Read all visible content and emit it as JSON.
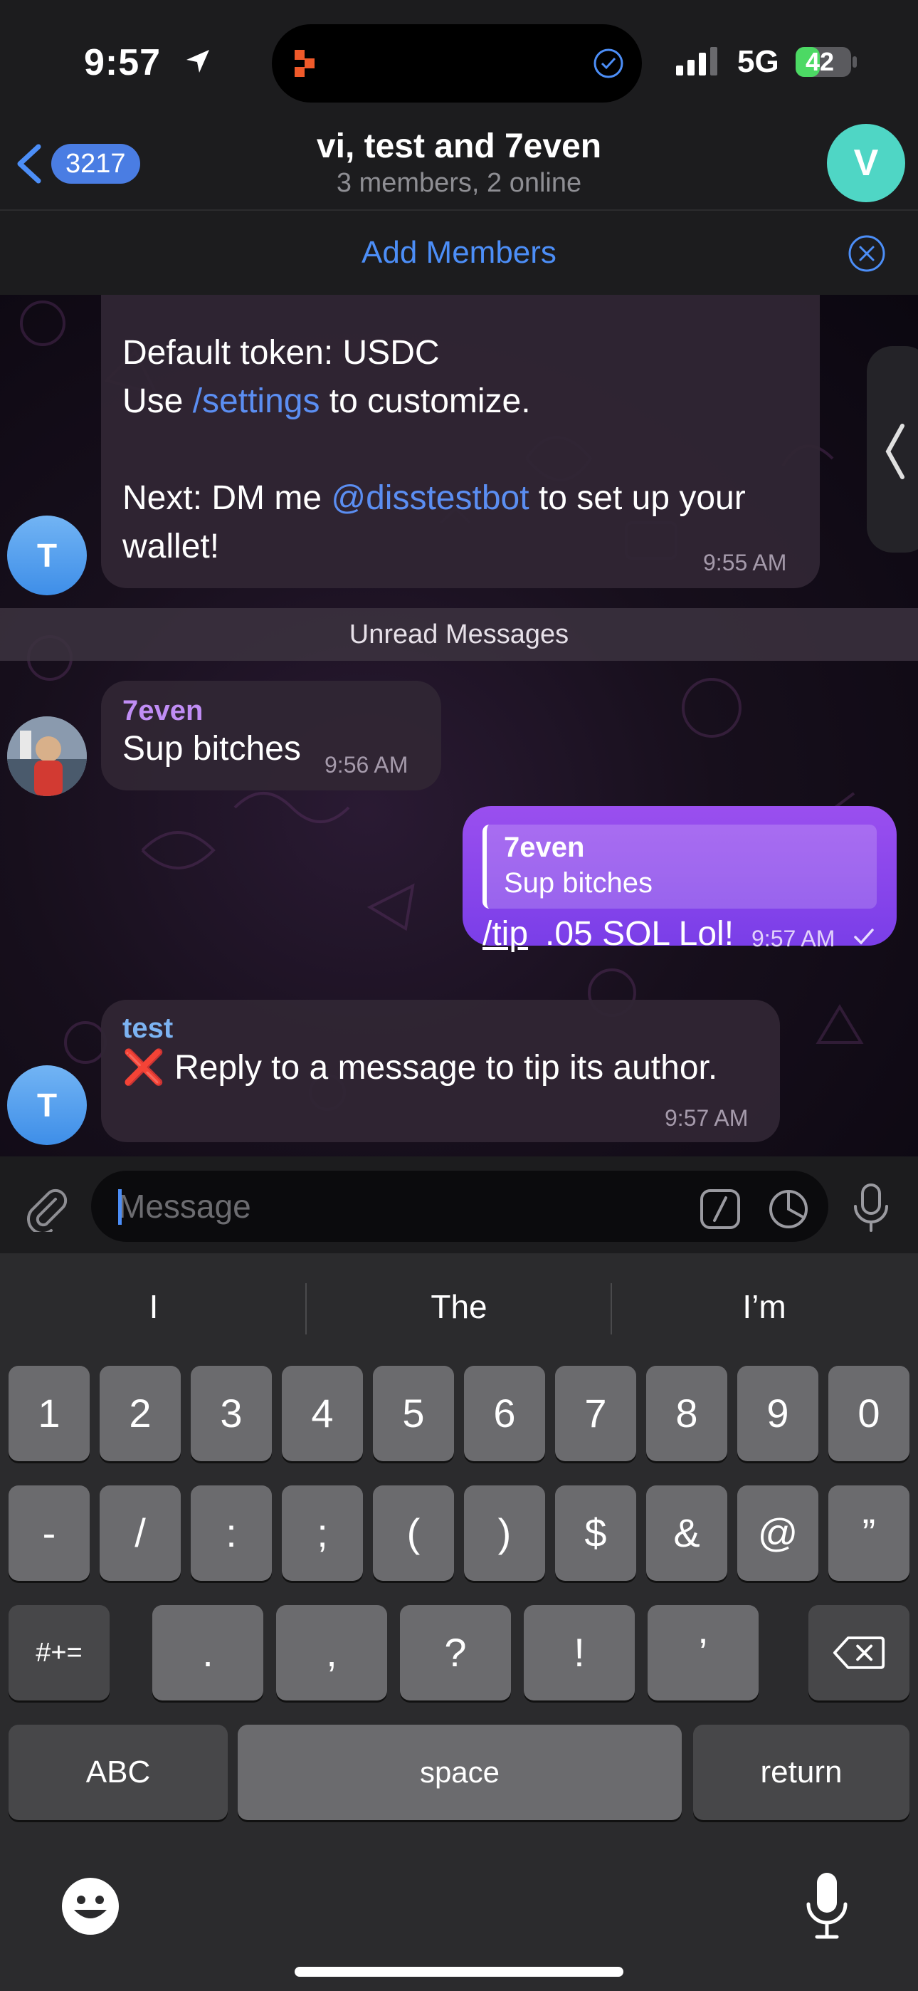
{
  "status": {
    "time": "9:57",
    "network": "5G",
    "battery": "42"
  },
  "header": {
    "back_count": "3217",
    "title": "vi, test and 7even",
    "subtitle": "3 members, 2 online",
    "avatar_letter": "V"
  },
  "add_members": {
    "label": "Add Members"
  },
  "messages": {
    "bot": {
      "line1": "Default token: USDC",
      "line2_pre": "Use ",
      "line2_link": "/settings",
      "line2_post": " to customize.",
      "line3_pre": "Next: DM me ",
      "line3_link": "@disstestbot",
      "line3_post": " to set up your",
      "line4": "wallet!",
      "time": "9:55 AM",
      "avatar_letter": "T"
    },
    "unread_label": "Unread Messages",
    "sevenen": {
      "sender": "7even",
      "text": "Sup bitches",
      "time": "9:56 AM"
    },
    "outgoing": {
      "reply_sender": "7even",
      "reply_text": "Sup bitches",
      "command": "/tip",
      "text": ".05 SOL Lol!",
      "time": "9:57 AM"
    },
    "test_reply": {
      "sender": "test",
      "emoji": "❌",
      "text": "Reply to a message to tip its author.",
      "time": "9:57 AM",
      "avatar_letter": "T"
    }
  },
  "composer": {
    "placeholder": "Message"
  },
  "keyboard": {
    "suggestions": [
      "I",
      "The",
      "I’m"
    ],
    "row1": [
      "1",
      "2",
      "3",
      "4",
      "5",
      "6",
      "7",
      "8",
      "9",
      "0"
    ],
    "row2": [
      "-",
      "/",
      ":",
      ";",
      "(",
      ")",
      "$",
      "&",
      "@",
      "”"
    ],
    "row3_mode": "#+=",
    "row3": [
      ".",
      ",",
      "?",
      "!",
      "’"
    ],
    "abc": "ABC",
    "space": "space",
    "return": "return"
  },
  "colors": {
    "accent": "#4c8ef7",
    "outgoing_bubble": "#8b46ee",
    "sender_7even": "#c08df5",
    "sender_test": "#7cb3f2",
    "avatar_group": "#4fd6c5"
  }
}
